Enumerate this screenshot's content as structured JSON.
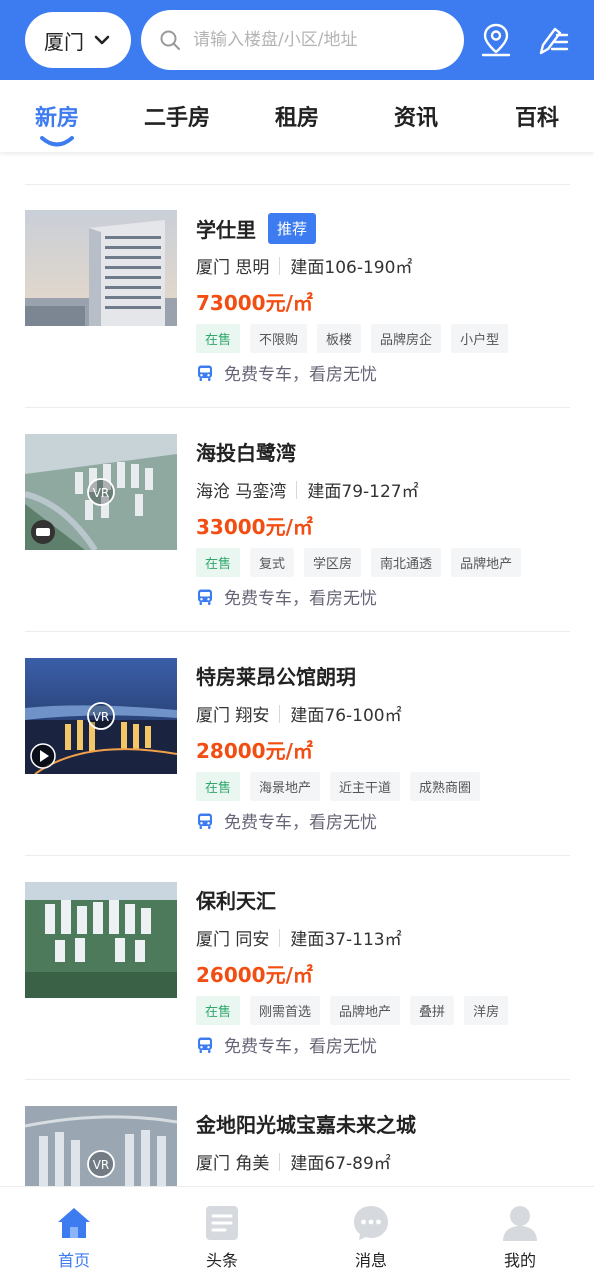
{
  "header": {
    "city": "厦门",
    "search_placeholder": "请输入楼盘/小区/地址",
    "accent_color": "#3d7cf0"
  },
  "tabs": [
    {
      "label": "新房",
      "active": true
    },
    {
      "label": "二手房",
      "active": false
    },
    {
      "label": "租房",
      "active": false
    },
    {
      "label": "资讯",
      "active": false
    },
    {
      "label": "百科",
      "active": false
    }
  ],
  "listings": [
    {
      "title": "学仕里",
      "badge": "推荐",
      "location": "厦门 思明",
      "area": "建面106-190㎡",
      "price": "73000元/㎡",
      "tags": [
        "在售",
        "不限购",
        "板楼",
        "品牌房企",
        "小户型"
      ],
      "service": "免费专车，看房无忧",
      "thumb_icon": "none"
    },
    {
      "title": "海投白鹭湾",
      "location": "海沧 马銮湾",
      "area": "建面79-127㎡",
      "price": "33000元/㎡",
      "tags": [
        "在售",
        "复式",
        "学区房",
        "南北通透",
        "品牌地产"
      ],
      "service": "免费专车，看房无忧",
      "thumb_icon": "drone-icon"
    },
    {
      "title": "特房莱昂公馆朗玥",
      "location": "厦门 翔安",
      "area": "建面76-100㎡",
      "price": "28000元/㎡",
      "tags": [
        "在售",
        "海景地产",
        "近主干道",
        "成熟商圈"
      ],
      "service": "免费专车，看房无忧",
      "thumb_icon": "play-icon"
    },
    {
      "title": "保利天汇",
      "location": "厦门 同安",
      "area": "建面37-113㎡",
      "price": "26000元/㎡",
      "tags": [
        "在售",
        "刚需首选",
        "品牌地产",
        "叠拼",
        "洋房"
      ],
      "service": "免费专车，看房无忧",
      "thumb_icon": "none"
    },
    {
      "title": "金地阳光城宝嘉未来之城",
      "location": "厦门 角美",
      "area": "建面67-89㎡",
      "thumb_icon": "vr-icon"
    }
  ],
  "bottom_nav": [
    {
      "label": "首页",
      "icon": "home-icon",
      "active": true
    },
    {
      "label": "头条",
      "icon": "news-icon",
      "active": false
    },
    {
      "label": "消息",
      "icon": "message-icon",
      "active": false
    },
    {
      "label": "我的",
      "icon": "profile-icon",
      "active": false
    }
  ],
  "colors": {
    "accent": "#3d7cf0",
    "price": "#f24d12",
    "on_sale_tag": "#2fa86d"
  }
}
